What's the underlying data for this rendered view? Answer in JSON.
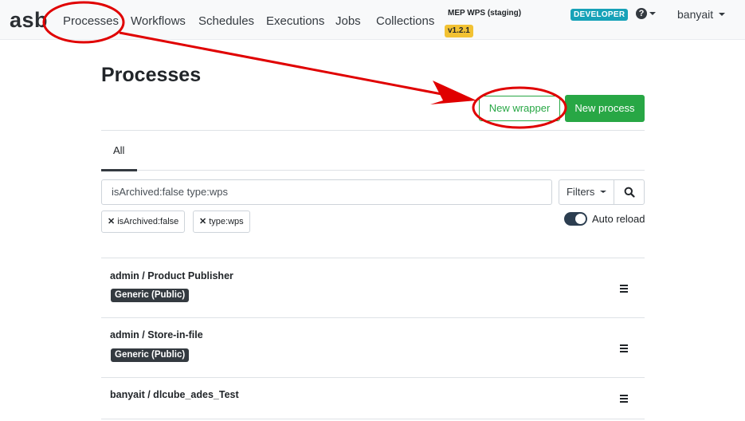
{
  "navbar": {
    "brand": "asb",
    "links": [
      "Processes",
      "Workflows",
      "Schedules",
      "Executions",
      "Jobs",
      "Collections"
    ],
    "environment": "MEP WPS (staging)",
    "version": "v1.2.1",
    "role_badge": "DEVELOPER",
    "help_icon": "question-circle-icon",
    "user": "banyait"
  },
  "page": {
    "title": "Processes",
    "new_wrapper_label": "New wrapper",
    "new_process_label": "New process",
    "tabs": [
      "All"
    ],
    "search_value": "isArchived:false type:wps",
    "filters_label": "Filters",
    "chips": [
      "isArchived:false",
      "type:wps"
    ],
    "auto_reload_label": "Auto reload",
    "auto_reload_on": true
  },
  "processes": [
    {
      "title": "admin / Product Publisher",
      "badge": "Generic (Public)"
    },
    {
      "title": "admin / Store-in-file",
      "badge": "Generic (Public)"
    },
    {
      "title": "banyait / dlcube_ades_Test",
      "badge": ""
    }
  ],
  "colors": {
    "accent_green": "#28a745",
    "annotation_red": "#e00000",
    "version_yellow": "#f2c233",
    "role_teal": "#17a2b8"
  }
}
